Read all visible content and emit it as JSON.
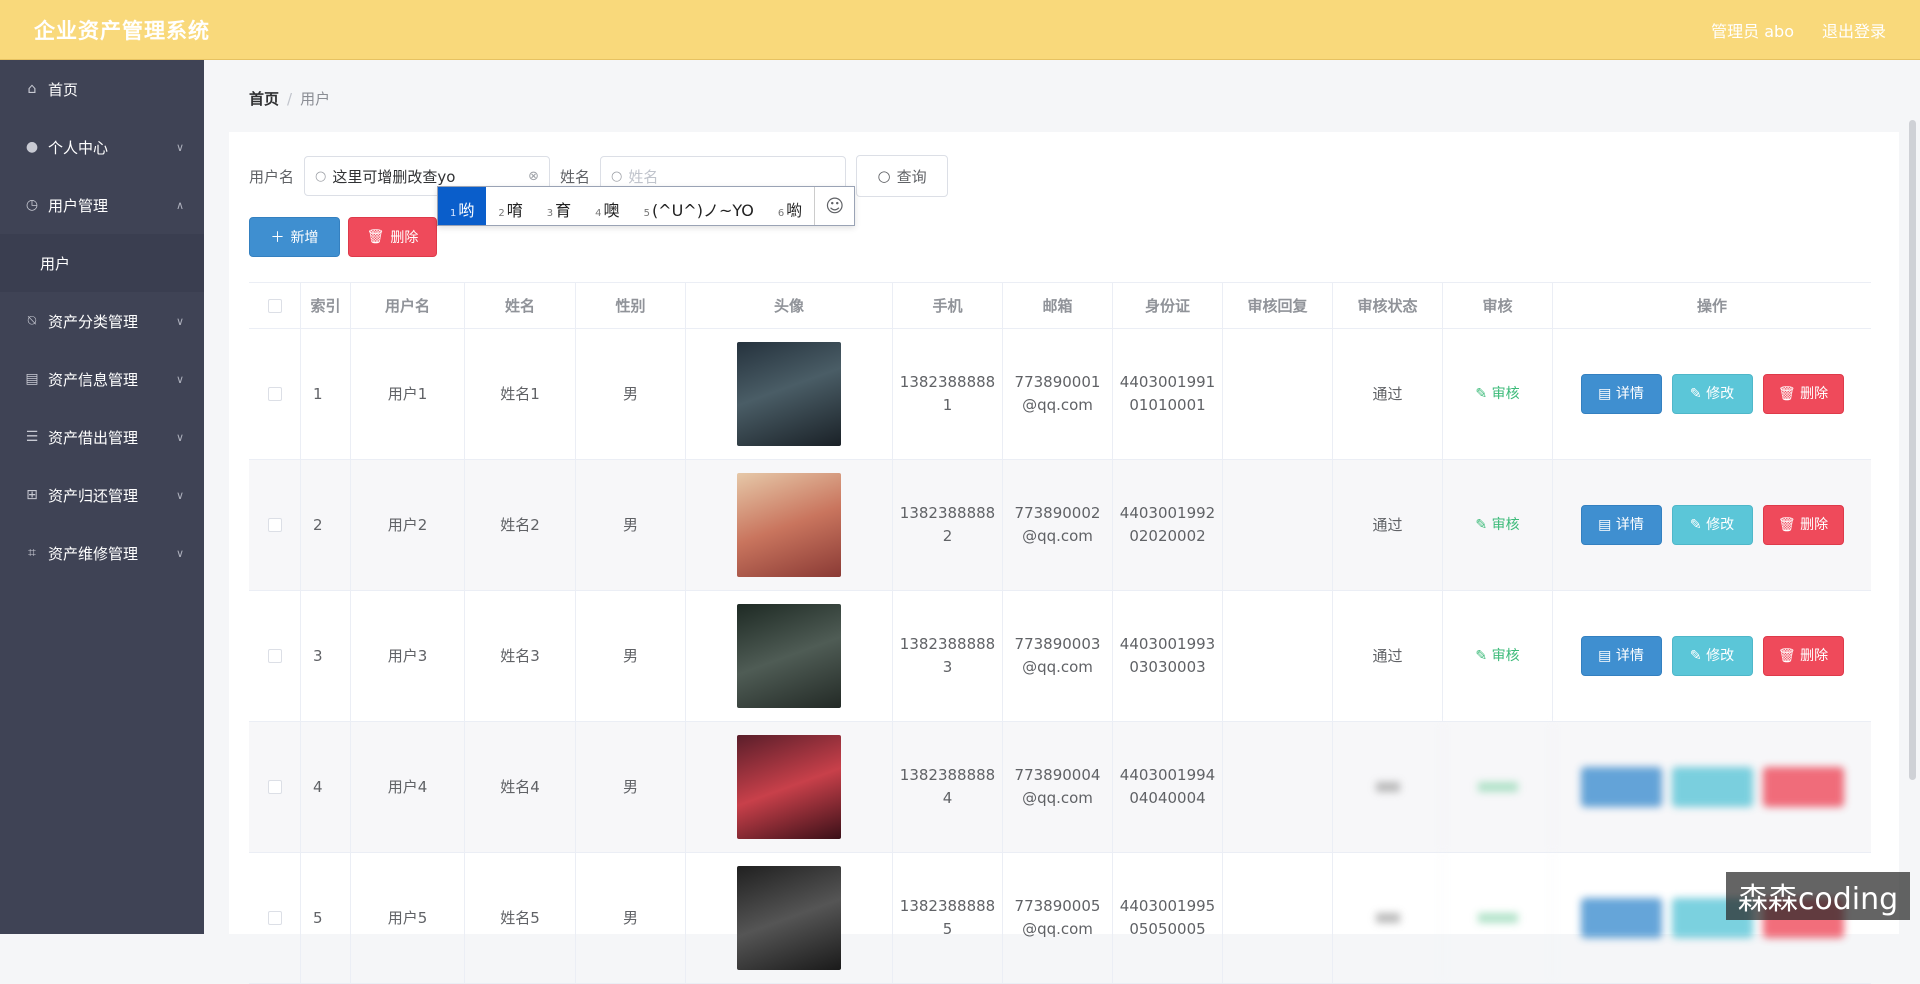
{
  "app": {
    "title": "企业资产管理系统",
    "admin_label": "管理员 abo",
    "logout_label": "退出登录"
  },
  "sidebar": {
    "items": [
      {
        "label": "首页",
        "icon": "home-icon"
      },
      {
        "label": "个人中心",
        "icon": "user-icon"
      },
      {
        "label": "用户管理",
        "icon": "clock-icon"
      },
      {
        "label": "资产分类管理",
        "icon": "bell-off-icon"
      },
      {
        "label": "资产信息管理",
        "icon": "chart-icon"
      },
      {
        "label": "资产借出管理",
        "icon": "list-icon"
      },
      {
        "label": "资产归还管理",
        "icon": "grid-icon"
      },
      {
        "label": "资产维修管理",
        "icon": "crop-icon"
      }
    ],
    "sub_item": "用户"
  },
  "breadcrumb": {
    "home": "首页",
    "sep": "/",
    "current": "用户"
  },
  "search": {
    "username_label": "用户名",
    "username_value": "这里可增删改查yo",
    "name_label": "姓名",
    "name_placeholder": "姓名",
    "query_label": "查询"
  },
  "ime": {
    "candidates": [
      {
        "n": "1",
        "text": "哟"
      },
      {
        "n": "2",
        "text": "唷"
      },
      {
        "n": "3",
        "text": "育"
      },
      {
        "n": "4",
        "text": "噢"
      },
      {
        "n": "5",
        "text": "(^U^)ノ~YO"
      },
      {
        "n": "6",
        "text": "喲"
      }
    ],
    "emoji": "☺"
  },
  "toolbar": {
    "add_label": "新增",
    "delete_label": "删除"
  },
  "table": {
    "headers": [
      "索引",
      "用户名",
      "姓名",
      "性别",
      "头像",
      "手机",
      "邮箱",
      "身份证",
      "审核回复",
      "审核状态",
      "审核",
      "操作"
    ],
    "rows": [
      {
        "index": "1",
        "username": "用户1",
        "name": "姓名1",
        "gender": "男",
        "phone1": "1382388888",
        "phone2": "1",
        "email1": "773890001",
        "email2": "@qq.com",
        "id1": "4403001991",
        "id2": "01010001",
        "reply": "",
        "status": "通过",
        "audit": "审核"
      },
      {
        "index": "2",
        "username": "用户2",
        "name": "姓名2",
        "gender": "男",
        "phone1": "1382388888",
        "phone2": "2",
        "email1": "773890002",
        "email2": "@qq.com",
        "id1": "4403001992",
        "id2": "02020002",
        "reply": "",
        "status": "通过",
        "audit": "审核"
      },
      {
        "index": "3",
        "username": "用户3",
        "name": "姓名3",
        "gender": "男",
        "phone1": "1382388888",
        "phone2": "3",
        "email1": "773890003",
        "email2": "@qq.com",
        "id1": "4403001993",
        "id2": "03030003",
        "reply": "",
        "status": "通过",
        "audit": "审核"
      },
      {
        "index": "4",
        "username": "用户4",
        "name": "姓名4",
        "gender": "男",
        "phone1": "1382388888",
        "phone2": "4",
        "email1": "773890004",
        "email2": "@qq.com",
        "id1": "4403001994",
        "id2": "04040004",
        "reply": "",
        "status": "",
        "audit": ""
      },
      {
        "index": "5",
        "username": "用户5",
        "name": "姓名5",
        "gender": "男",
        "phone1": "1382388888",
        "phone2": "5",
        "email1": "773890005",
        "email2": "@qq.com",
        "id1": "4403001995",
        "id2": "05050005",
        "reply": "",
        "status": "",
        "audit": ""
      }
    ],
    "op_detail": "详情",
    "op_edit": "修改",
    "op_delete": "删除"
  },
  "watermark": "森森coding",
  "colors": {
    "header": "#f9d97b",
    "sidebar": "#3f4355",
    "primary": "#3f8fd0",
    "info": "#5bc6d8",
    "danger": "#ef4a5b",
    "success": "#3dbb7a"
  }
}
